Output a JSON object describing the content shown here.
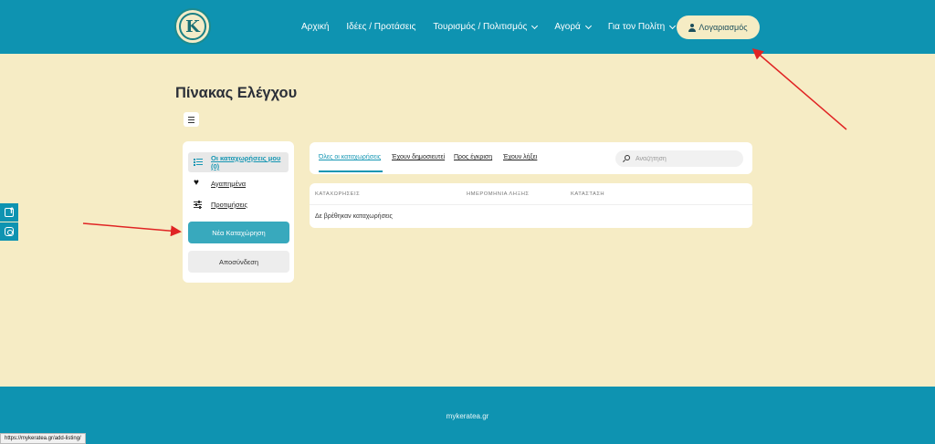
{
  "header": {
    "logo_letter": "K",
    "nav": [
      {
        "label": "Αρχική",
        "dropdown": false
      },
      {
        "label": "Ιδέες / Προτάσεις",
        "dropdown": false
      },
      {
        "label": "Τουρισμός / Πολιτισμός",
        "dropdown": true
      },
      {
        "label": "Αγορά",
        "dropdown": true
      },
      {
        "label": "Για τον Πολίτη",
        "dropdown": true
      }
    ],
    "account_label": "Λογαριασμός"
  },
  "page": {
    "title": "Πίνακας Ελέγχου"
  },
  "sidebar": {
    "items": [
      {
        "label": "Οι καταχωρήσεις μου (0)",
        "icon": "list-icon",
        "active": true
      },
      {
        "label": "Αγαπημένα",
        "icon": "heart-icon",
        "active": false
      },
      {
        "label": "Προτιμήσεις",
        "icon": "sliders-icon",
        "active": false
      }
    ],
    "new_listing_label": "Νέα Καταχώρηση",
    "logout_label": "Αποσύνδεση"
  },
  "tabs": {
    "items": [
      {
        "label": "Όλες οι καταχωρήσεις",
        "active": true
      },
      {
        "label": "Έχουν δημοσιευτεί",
        "active": false
      },
      {
        "label": "Προς έγκριση",
        "active": false
      },
      {
        "label": "Έχουν λήξει",
        "active": false
      }
    ],
    "search_placeholder": "Αναζήτηση"
  },
  "table": {
    "columns": [
      "ΚΑΤΑΧΩΡΗΣΕΙΣ",
      "ΗΜΕΡΟΜΗΝΙΑ ΛΗΞΗΣ",
      "ΚΑΤΑΣΤΑΣΗ"
    ],
    "empty_message": "Δε βρέθηκαν καταχωρήσεις"
  },
  "social": {
    "items": [
      {
        "icon": "facebook-icon"
      },
      {
        "icon": "instagram-icon"
      }
    ]
  },
  "footer": {
    "text": "mykeratea.gr"
  },
  "status_bar": {
    "url": "https://mykeratea.gr/add-listing/"
  },
  "colors": {
    "header_bg": "#0e93b1",
    "page_bg": "#f6ecc5",
    "accent": "#1596b3",
    "button_primary": "#38a9bd",
    "annotation_arrow": "#e02424"
  }
}
